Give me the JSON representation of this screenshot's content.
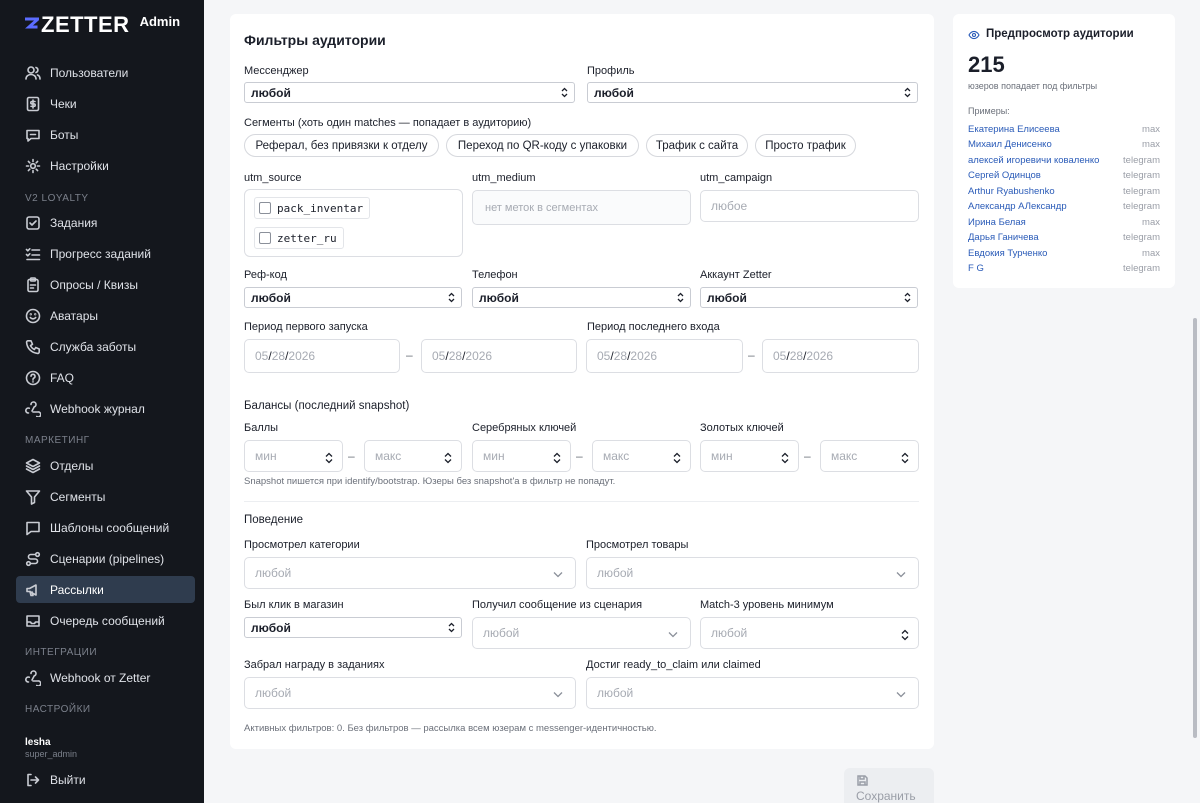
{
  "app": {
    "logo": "ZETTER",
    "badge": "Admin"
  },
  "sidebar": {
    "items": [
      {
        "label": "Пользователи",
        "icon": "users-icon"
      },
      {
        "label": "Чеки",
        "icon": "receipt-icon"
      },
      {
        "label": "Боты",
        "icon": "bot-icon"
      },
      {
        "label": "Настройки",
        "icon": "gear-icon"
      }
    ],
    "section_loyalty": "V2 LOYALTY",
    "loyalty": [
      {
        "label": "Задания",
        "icon": "checkbox-icon"
      },
      {
        "label": "Прогресс заданий",
        "icon": "list-check-icon"
      },
      {
        "label": "Опросы / Квизы",
        "icon": "clipboard-icon"
      },
      {
        "label": "Аватары",
        "icon": "smile-icon"
      },
      {
        "label": "Служба заботы",
        "icon": "phone-icon"
      },
      {
        "label": "FAQ",
        "icon": "help-icon"
      },
      {
        "label": "Webhook журнал",
        "icon": "webhook-icon"
      }
    ],
    "section_marketing": "МАРКЕТИНГ",
    "marketing": [
      {
        "label": "Отделы",
        "icon": "layers-icon"
      },
      {
        "label": "Сегменты",
        "icon": "filter-icon"
      },
      {
        "label": "Шаблоны сообщений",
        "icon": "message-icon"
      },
      {
        "label": "Сценарии (pipelines)",
        "icon": "route-icon"
      },
      {
        "label": "Рассылки",
        "icon": "megaphone-icon"
      },
      {
        "label": "Очередь сообщений",
        "icon": "queue-icon"
      }
    ],
    "section_integrations": "ИНТЕГРАЦИИ",
    "integrations": [
      {
        "label": "Webhook от Zetter",
        "icon": "webhook-icon"
      }
    ],
    "section_settings": "НАСТРОЙКИ",
    "user": {
      "name": "lesha",
      "role": "super_admin"
    },
    "logout": "Выйти"
  },
  "filters": {
    "title": "Фильтры аудитории",
    "messenger": {
      "label": "Мессенджер",
      "value": "любой"
    },
    "profile": {
      "label": "Профиль",
      "value": "любой"
    },
    "segments": {
      "label": "Сегменты (хоть один matches — попадает в аудиторию)",
      "pills": [
        "Реферал, без привязки к отделу",
        "Переход по QR-коду с упаковки",
        "Трафик с сайта",
        "Просто трафик"
      ]
    },
    "utm_source": {
      "label": "utm_source",
      "options": [
        "pack_inventar",
        "zetter_ru"
      ]
    },
    "utm_medium": {
      "label": "utm_medium",
      "placeholder": "нет меток в сегментах"
    },
    "utm_campaign": {
      "label": "utm_campaign",
      "placeholder": "любое"
    },
    "ref_code": {
      "label": "Реф-код",
      "value": "любой"
    },
    "phone": {
      "label": "Телефон",
      "value": "любой"
    },
    "zetter_account": {
      "label": "Аккаунт Zetter",
      "value": "любой"
    },
    "first_launch": {
      "label": "Период первого запуска"
    },
    "last_login": {
      "label": "Период последнего входа"
    },
    "date": {
      "mm": "05",
      "dd": "28",
      "yyyy": "2026",
      "sep": "/"
    },
    "dash": "–",
    "balances_title": "Балансы (последний snapshot)",
    "points": {
      "label": "Баллы"
    },
    "silver": {
      "label": "Серебряных ключей"
    },
    "gold": {
      "label": "Золотых ключей"
    },
    "min_ph": "мин",
    "max_ph": "макс",
    "snapshot_hint": "Snapshot пишется при identify/bootstrap. Юзеры без snapshot'а в фильтр не попадут.",
    "behavior_title": "Поведение",
    "viewed_categories": {
      "label": "Просмотрел категории",
      "placeholder": "любой"
    },
    "viewed_products": {
      "label": "Просмотрел товары",
      "placeholder": "любой"
    },
    "store_click": {
      "label": "Был клик в магазин",
      "value": "любой"
    },
    "scenario_msg": {
      "label": "Получил сообщение из сценария",
      "placeholder": "любой"
    },
    "match3": {
      "label": "Match-3 уровень минимум",
      "placeholder": "любой"
    },
    "task_reward": {
      "label": "Забрал награду в заданиях",
      "placeholder": "любой"
    },
    "ready_claim": {
      "label": "Достиг ready_to_claim или claimed",
      "placeholder": "любой"
    },
    "active_hint": "Активных фильтров: 0. Без фильтров — рассылка всем юзерам с messenger-идентичностью."
  },
  "preview": {
    "title": "Предпросмотр аудитории",
    "count": "215",
    "count_sub": "юзеров попадает под фильтры",
    "examples_label": "Примеры:",
    "examples": [
      {
        "name": "Екатерина Елисеева",
        "channel": "max"
      },
      {
        "name": "Михаил Денисенко",
        "channel": "max"
      },
      {
        "name": "алексей игоревичи коваленко",
        "channel": "telegram"
      },
      {
        "name": "Сергей Одинцов",
        "channel": "telegram"
      },
      {
        "name": "Arthur Ryabushenko",
        "channel": "telegram"
      },
      {
        "name": "Александр АЛександр",
        "channel": "telegram"
      },
      {
        "name": "Ирина Белая",
        "channel": "max"
      },
      {
        "name": "Дарья Ганичева",
        "channel": "telegram"
      },
      {
        "name": "Евдокия Турченко",
        "channel": "max"
      },
      {
        "name": "F G",
        "channel": "telegram"
      }
    ]
  },
  "save_label": "Сохранить"
}
